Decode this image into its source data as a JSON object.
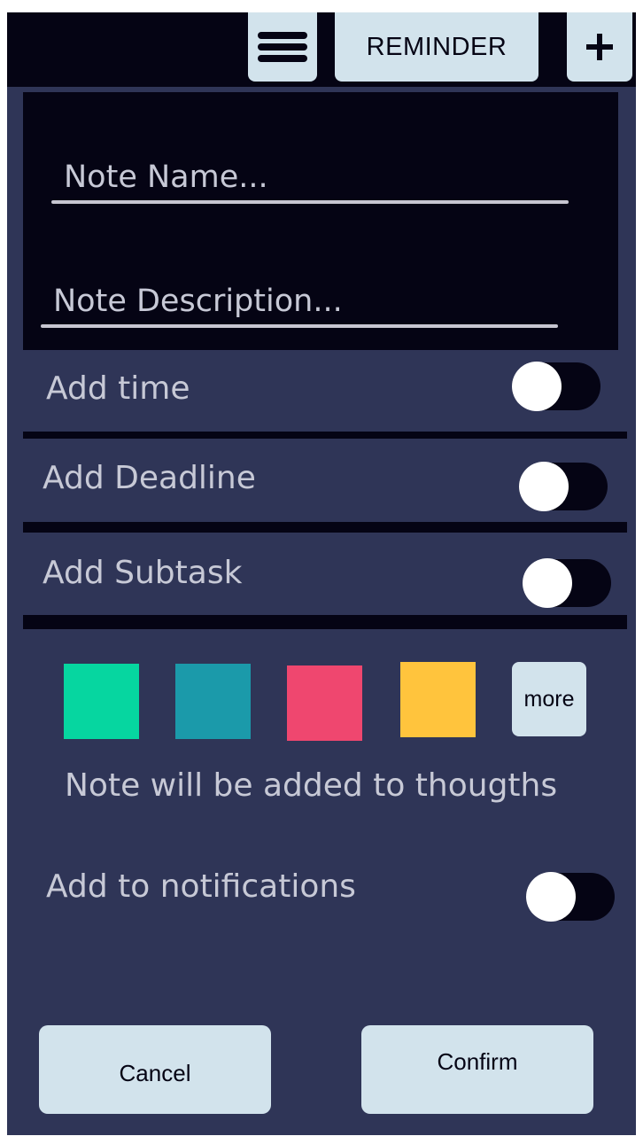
{
  "topbar": {
    "menu_icon": "hamburger-menu-icon",
    "reminder_label": "REMINDER",
    "plus_label": "+"
  },
  "note": {
    "name_placeholder": "Note Name...",
    "description_placeholder": "Note Description..."
  },
  "options": [
    {
      "label": "Add time",
      "enabled": false
    },
    {
      "label": "Add Deadline",
      "enabled": false
    },
    {
      "label": "Add Subtask",
      "enabled": false
    }
  ],
  "colors": {
    "swatches": [
      "#06d6a0",
      "#1b9aaa",
      "#ef476f",
      "#ffc43d"
    ],
    "more_label": "more"
  },
  "info_text": "Note will be added to thougths",
  "notifications": {
    "label": "Add to notifications",
    "enabled": false
  },
  "actions": {
    "cancel_label": "Cancel",
    "confirm_label": "Confirm"
  },
  "theme": {
    "background": "#2f3557",
    "dark": "#050414",
    "button": "#d2e3ec",
    "text": "#c7c9d6"
  }
}
